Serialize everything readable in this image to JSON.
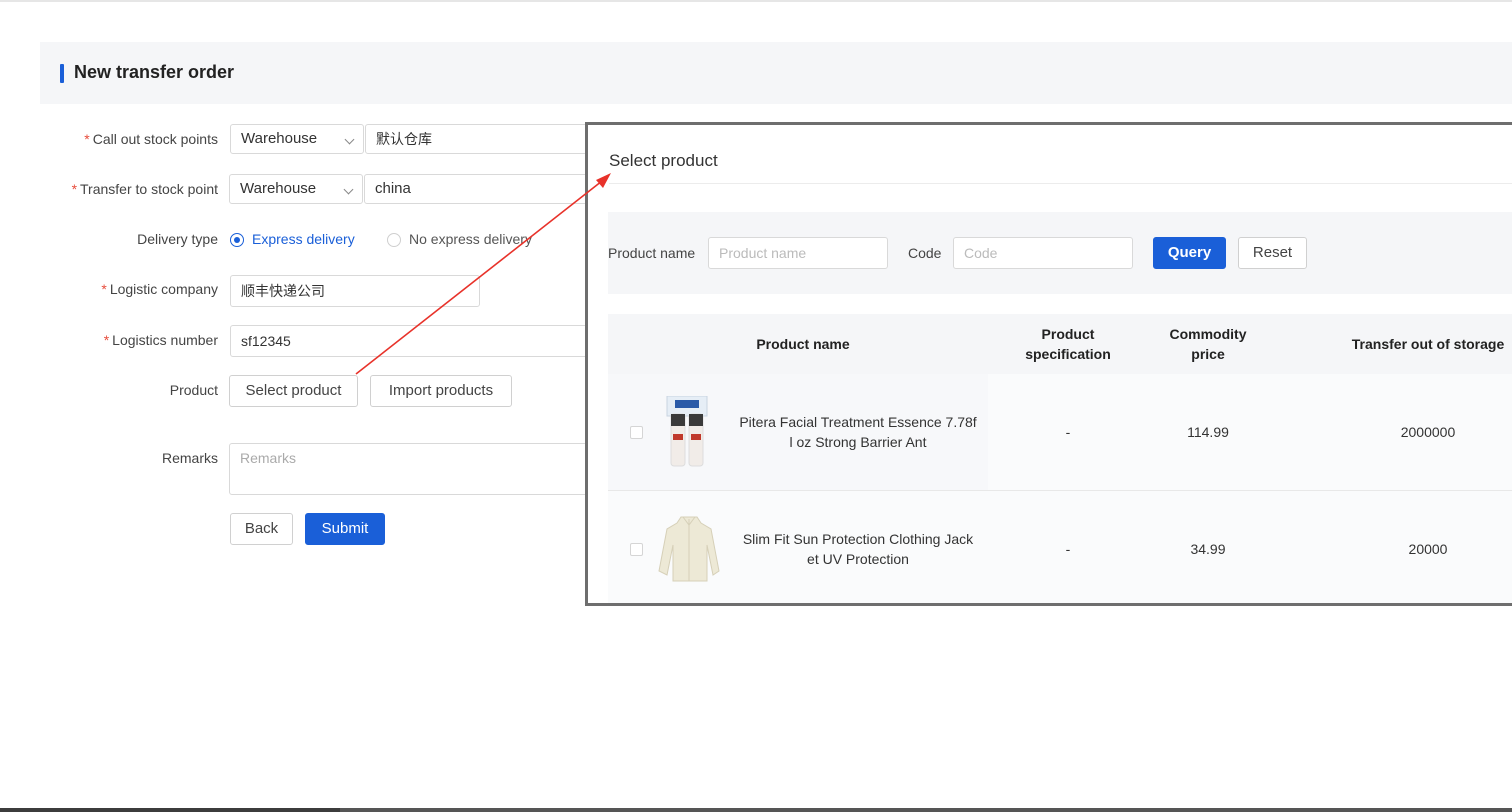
{
  "page": {
    "title": "New transfer order"
  },
  "form": {
    "call_out": {
      "label": "Call out stock points",
      "type_value": "Warehouse",
      "value": "默认仓库"
    },
    "transfer_to": {
      "label": "Transfer to stock point",
      "type_value": "Warehouse",
      "value": "china"
    },
    "delivery_type": {
      "label": "Delivery type",
      "options": [
        "Express delivery",
        "No express delivery"
      ],
      "selected": "Express delivery"
    },
    "logistic_company": {
      "label": "Logistic company",
      "value": "顺丰快递公司"
    },
    "logistics_number": {
      "label": "Logistics number",
      "value": "sf12345"
    },
    "product": {
      "label": "Product",
      "select_button": "Select product",
      "import_button": "Import products"
    },
    "remarks": {
      "label": "Remarks",
      "placeholder": "Remarks"
    },
    "back_button": "Back",
    "submit_button": "Submit",
    "required_mark": "*"
  },
  "modal": {
    "title": "Select product",
    "filter": {
      "name_label": "Product name",
      "name_placeholder": "Product name",
      "code_label": "Code",
      "code_placeholder": "Code",
      "query_button": "Query",
      "reset_button": "Reset"
    },
    "table": {
      "headers": {
        "name": "Product name",
        "spec_line1": "Product",
        "spec_line2": "specification",
        "price_line1": "Commodity",
        "price_line2": "price",
        "storage": "Transfer out of storage"
      },
      "rows": [
        {
          "name_line1": "Pitera Facial Treatment Essence 7.78f",
          "name_line2": "l oz Strong Barrier Ant",
          "spec": "-",
          "price": "114.99",
          "storage": "2000000",
          "image": "essence-bottles-image"
        },
        {
          "name_line1": "Slim Fit Sun Protection Clothing Jack",
          "name_line2": "et UV Protection",
          "spec": "-",
          "price": "34.99",
          "storage": "20000",
          "image": "jacket-image"
        }
      ]
    }
  },
  "colors": {
    "primary": "#1a5fd8",
    "required": "#e74c3c",
    "annotation_arrow": "#e8322a"
  }
}
